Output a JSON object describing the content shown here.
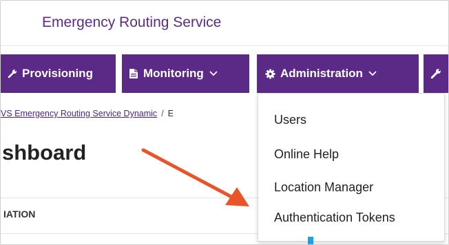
{
  "header": {
    "title": "Emergency Routing Service"
  },
  "nav": {
    "items": [
      {
        "label": "Provisioning",
        "icon": "wrench-icon",
        "has_dropdown": false
      },
      {
        "label": "Monitoring",
        "icon": "document-icon",
        "has_dropdown": true
      },
      {
        "label": "Administration",
        "icon": "gear-icon",
        "has_dropdown": true,
        "active": true
      },
      {
        "label": "",
        "icon": "wrench-icon",
        "has_dropdown": false
      }
    ]
  },
  "breadcrumb": {
    "link": "VS Emergency Routing Service Dynamic",
    "separator": "/",
    "current": "E"
  },
  "page": {
    "title": "shboard",
    "section_label": "IATION"
  },
  "admin_menu": {
    "items": [
      "Users",
      "Online Help",
      "Location Manager",
      "Authentication Tokens"
    ]
  },
  "colors": {
    "nav_bg": "#5b2a86",
    "title_text": "#5b2c86",
    "annotation_arrow": "#e8552a",
    "cursor_mark": "#19a3e6"
  }
}
